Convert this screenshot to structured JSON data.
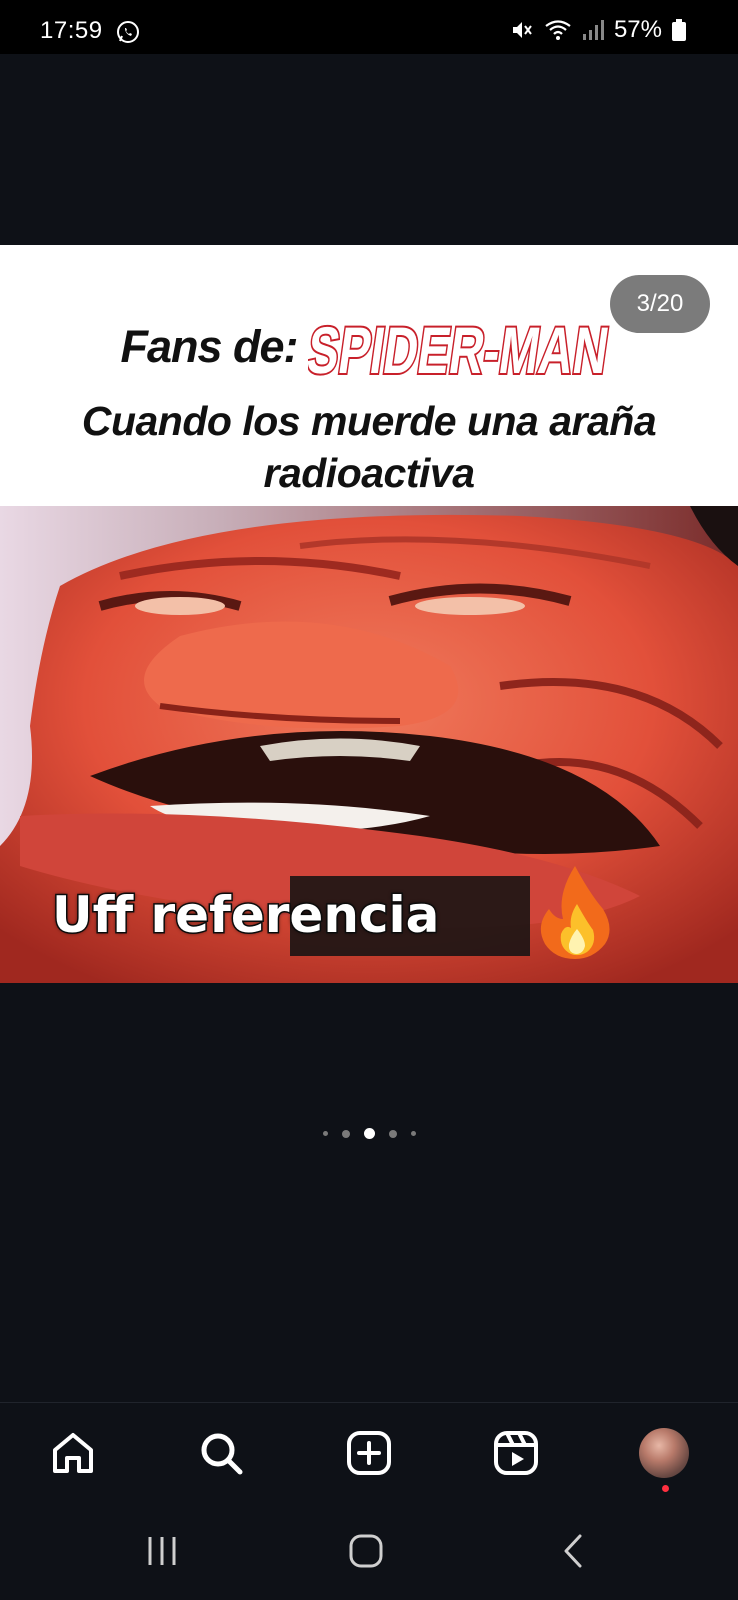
{
  "status_bar": {
    "time": "17:59",
    "battery_percent": "57%",
    "icons": [
      "whatsapp-icon",
      "mute-icon",
      "wifi-icon",
      "signal-icon",
      "battery-icon"
    ]
  },
  "post": {
    "counter": "3/20",
    "caption_prefix": "Fans de:",
    "logo_text": "SPIDER-MAN",
    "caption_line": "Cuando los muerde una araña radioactiva",
    "meme_text": "Uff referencia",
    "emoji": "fire-emoji"
  },
  "carousel": {
    "dot_count": 5,
    "active_index": 2
  },
  "bottom_nav": {
    "items": [
      "home-icon",
      "search-icon",
      "create-icon",
      "reels-icon",
      "profile-avatar"
    ]
  },
  "system_nav": {
    "items": [
      "recents-icon",
      "home-button-icon",
      "back-icon"
    ]
  },
  "colors": {
    "background": "#0e1117",
    "notification_dot": "#ff3040",
    "logo_red": "#c8202a"
  }
}
